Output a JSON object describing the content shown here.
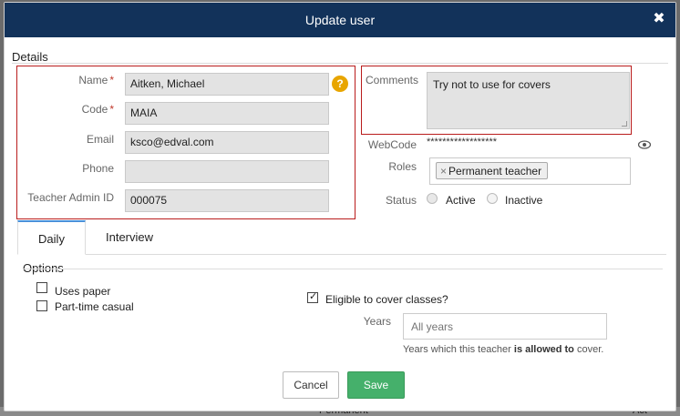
{
  "modal": {
    "title": "Update user",
    "close_symbol": "✖"
  },
  "details": {
    "section_title": "Details",
    "name": {
      "label": "Name",
      "required_mark": "*",
      "value": "Aitken, Michael",
      "help_symbol": "?"
    },
    "code": {
      "label": "Code",
      "required_mark": "*",
      "value": "MAIA"
    },
    "email": {
      "label": "Email",
      "value": "ksco@edval.com"
    },
    "phone": {
      "label": "Phone",
      "value": ""
    },
    "teacher_admin_id": {
      "label": "Teacher Admin ID",
      "value": "000075"
    },
    "comments": {
      "label": "Comments",
      "value": "Try not to use for covers"
    },
    "webcode": {
      "label": "WebCode",
      "value": "******************"
    },
    "roles": {
      "label": "Roles",
      "tag_remove": "×",
      "tag": "Permanent teacher"
    },
    "status": {
      "label": "Status",
      "options": [
        "Active",
        "Inactive"
      ],
      "selected": "Active"
    }
  },
  "tabs": [
    {
      "label": "Daily",
      "active": true
    },
    {
      "label": "Interview",
      "active": false
    }
  ],
  "options": {
    "section_title": "Options",
    "uses_paper": {
      "label": "Uses paper",
      "checked": false
    },
    "part_time_casual": {
      "label": "Part-time casual",
      "checked": false
    },
    "eligible_cover": {
      "label": "Eligible to cover classes?",
      "checked": true
    },
    "years": {
      "label": "Years",
      "placeholder": "All years",
      "hint_prefix": "Years which this teacher ",
      "hint_bold": "is allowed to",
      "hint_suffix": " cover."
    }
  },
  "buttons": {
    "cancel": "Cancel",
    "save": "Save"
  },
  "background": {
    "row_text": "Permanent",
    "row_text_right": "Act"
  },
  "colors": {
    "header": "#12325a",
    "required_box": "#b91c1c",
    "save": "#45b06b",
    "help_icon": "#e8a500",
    "active_tab": "#4a90d9"
  }
}
